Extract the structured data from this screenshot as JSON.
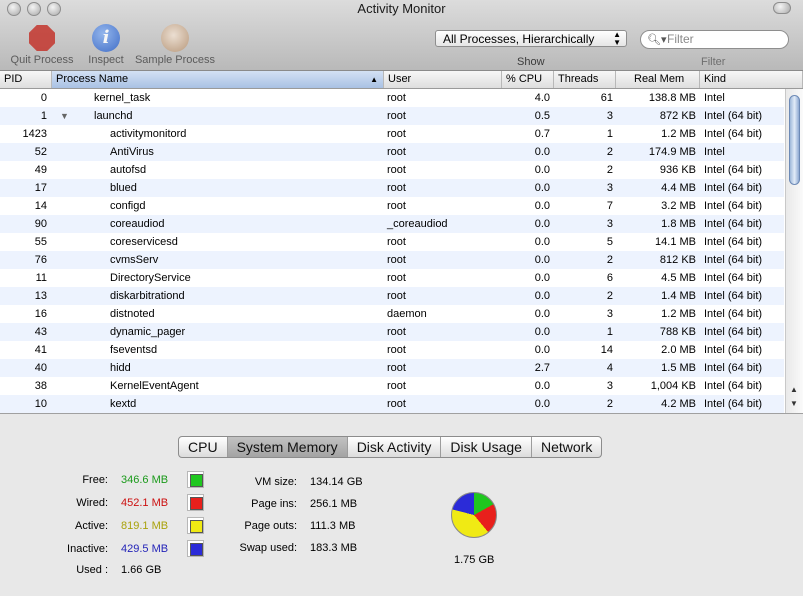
{
  "window": {
    "title": "Activity Monitor"
  },
  "toolbar": {
    "quit_label": "Quit Process",
    "inspect_label": "Inspect",
    "sample_label": "Sample Process",
    "show_label": "Show",
    "show_value": "All Processes, Hierarchically",
    "filter_placeholder": "Filter",
    "filter_label": "Filter"
  },
  "table": {
    "columns": {
      "pid": "PID",
      "name": "Process Name",
      "user": "User",
      "cpu": "% CPU",
      "threads": "Threads",
      "mem": "Real Mem",
      "kind": "Kind"
    },
    "rows": [
      {
        "pid": "0",
        "name": "kernel_task",
        "user": "root",
        "cpu": "4.0",
        "threads": "61",
        "mem": "138.8 MB",
        "kind": "Intel",
        "level": 0
      },
      {
        "pid": "1",
        "name": "launchd",
        "user": "root",
        "cpu": "0.5",
        "threads": "3",
        "mem": "872 KB",
        "kind": "Intel (64 bit)",
        "level": 0,
        "expanded": true
      },
      {
        "pid": "1423",
        "name": "activitymonitord",
        "user": "root",
        "cpu": "0.7",
        "threads": "1",
        "mem": "1.2 MB",
        "kind": "Intel (64 bit)",
        "level": 1
      },
      {
        "pid": "52",
        "name": "AntiVirus",
        "user": "root",
        "cpu": "0.0",
        "threads": "2",
        "mem": "174.9 MB",
        "kind": "Intel",
        "level": 1
      },
      {
        "pid": "49",
        "name": "autofsd",
        "user": "root",
        "cpu": "0.0",
        "threads": "2",
        "mem": "936 KB",
        "kind": "Intel (64 bit)",
        "level": 1
      },
      {
        "pid": "17",
        "name": "blued",
        "user": "root",
        "cpu": "0.0",
        "threads": "3",
        "mem": "4.4 MB",
        "kind": "Intel (64 bit)",
        "level": 1
      },
      {
        "pid": "14",
        "name": "configd",
        "user": "root",
        "cpu": "0.0",
        "threads": "7",
        "mem": "3.2 MB",
        "kind": "Intel (64 bit)",
        "level": 1
      },
      {
        "pid": "90",
        "name": "coreaudiod",
        "user": "_coreaudiod",
        "cpu": "0.0",
        "threads": "3",
        "mem": "1.8 MB",
        "kind": "Intel (64 bit)",
        "level": 1
      },
      {
        "pid": "55",
        "name": "coreservicesd",
        "user": "root",
        "cpu": "0.0",
        "threads": "5",
        "mem": "14.1 MB",
        "kind": "Intel (64 bit)",
        "level": 1
      },
      {
        "pid": "76",
        "name": "cvmsServ",
        "user": "root",
        "cpu": "0.0",
        "threads": "2",
        "mem": "812 KB",
        "kind": "Intel (64 bit)",
        "level": 1
      },
      {
        "pid": "11",
        "name": "DirectoryService",
        "user": "root",
        "cpu": "0.0",
        "threads": "6",
        "mem": "4.5 MB",
        "kind": "Intel (64 bit)",
        "level": 1
      },
      {
        "pid": "13",
        "name": "diskarbitrationd",
        "user": "root",
        "cpu": "0.0",
        "threads": "2",
        "mem": "1.4 MB",
        "kind": "Intel (64 bit)",
        "level": 1
      },
      {
        "pid": "16",
        "name": "distnoted",
        "user": "daemon",
        "cpu": "0.0",
        "threads": "3",
        "mem": "1.2 MB",
        "kind": "Intel (64 bit)",
        "level": 1
      },
      {
        "pid": "43",
        "name": "dynamic_pager",
        "user": "root",
        "cpu": "0.0",
        "threads": "1",
        "mem": "788 KB",
        "kind": "Intel (64 bit)",
        "level": 1
      },
      {
        "pid": "41",
        "name": "fseventsd",
        "user": "root",
        "cpu": "0.0",
        "threads": "14",
        "mem": "2.0 MB",
        "kind": "Intel (64 bit)",
        "level": 1
      },
      {
        "pid": "40",
        "name": "hidd",
        "user": "root",
        "cpu": "2.7",
        "threads": "4",
        "mem": "1.5 MB",
        "kind": "Intel (64 bit)",
        "level": 1
      },
      {
        "pid": "38",
        "name": "KernelEventAgent",
        "user": "root",
        "cpu": "0.0",
        "threads": "3",
        "mem": "1,004 KB",
        "kind": "Intel (64 bit)",
        "level": 1
      },
      {
        "pid": "10",
        "name": "kextd",
        "user": "root",
        "cpu": "0.0",
        "threads": "2",
        "mem": "4.2 MB",
        "kind": "Intel (64 bit)",
        "level": 1
      }
    ]
  },
  "tabs": [
    "CPU",
    "System Memory",
    "Disk Activity",
    "Disk Usage",
    "Network"
  ],
  "active_tab": "System Memory",
  "memory": {
    "free_label": "Free:",
    "free_value": "346.6 MB",
    "free_color": "#1fc71f",
    "wired_label": "Wired:",
    "wired_value": "452.1 MB",
    "wired_color": "#e8201c",
    "active_label": "Active:",
    "active_value": "819.1 MB",
    "active_color": "#f0ea14",
    "inactive_label": "Inactive:",
    "inactive_value": "429.5 MB",
    "inactive_color": "#2b2bd8",
    "used_label": "Used :",
    "used_value": "1.66 GB",
    "vmsize_label": "VM size:",
    "vmsize_value": "134.14 GB",
    "pageins_label": "Page ins:",
    "pageins_value": "256.1 MB",
    "pageouts_label": "Page outs:",
    "pageouts_value": "111.3 MB",
    "swap_label": "Swap used:",
    "swap_value": "183.3 MB",
    "total_value": "1.75 GB"
  }
}
